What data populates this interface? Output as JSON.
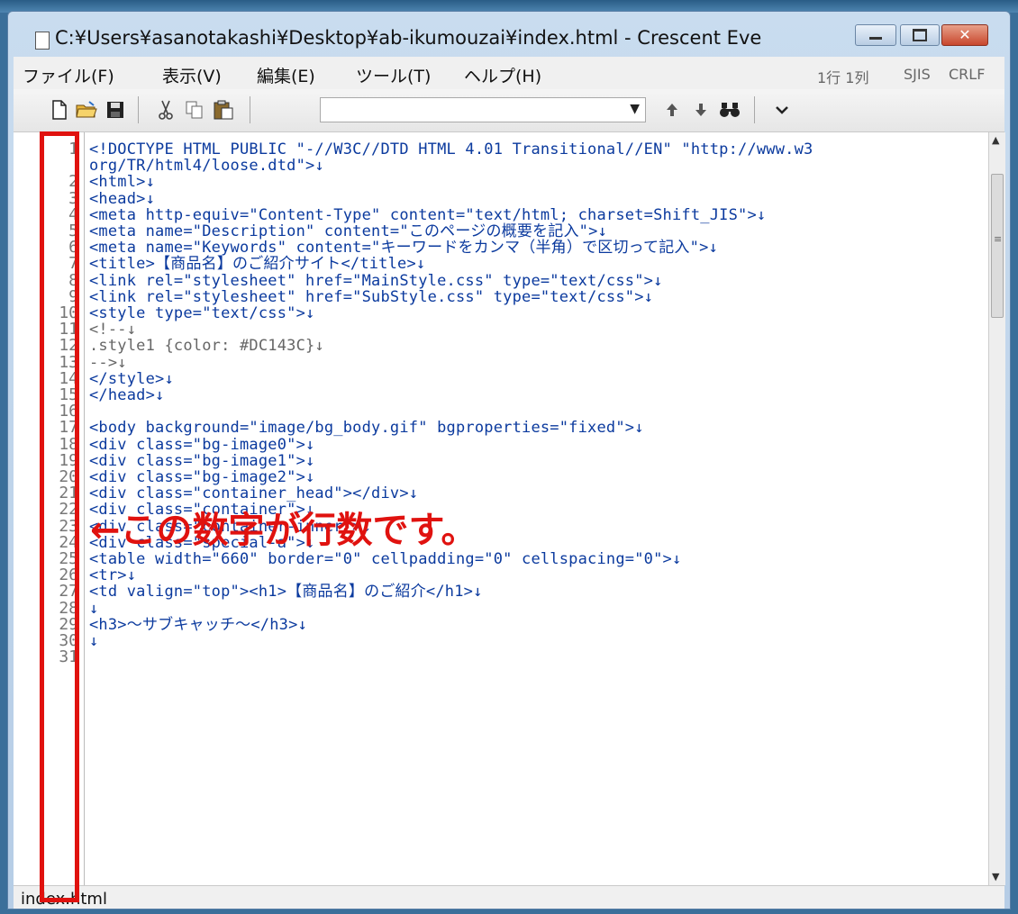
{
  "window": {
    "title": "C:¥Users¥asanotakashi¥Desktop¥ab-ikumouzai¥index.html - Crescent Eve"
  },
  "menu": {
    "items": [
      {
        "label": "ファイル(F)"
      },
      {
        "label": "表示(V)"
      },
      {
        "label": "編集(E)"
      },
      {
        "label": "ツール(T)"
      },
      {
        "label": "ヘルプ(H)"
      }
    ],
    "status_position": "1行 1列",
    "status_encoding": "SJIS",
    "status_newline": "CRLF"
  },
  "toolbar": {
    "icons": [
      "new-file-icon",
      "open-folder-icon",
      "save-icon",
      "cut-icon",
      "copy-icon",
      "paste-icon"
    ],
    "search_value": "",
    "nav_icons": [
      "arrow-up-icon",
      "arrow-down-icon",
      "find-icon",
      "chevron-down-icon"
    ]
  },
  "editor": {
    "line_numbers": [
      "1",
      "",
      "2",
      "3",
      "4",
      "5",
      "6",
      "7",
      "8",
      "9",
      "10",
      "11",
      "12",
      "13",
      "14",
      "15",
      "16",
      "17",
      "18",
      "19",
      "20",
      "21",
      "22",
      "23",
      "24",
      "25",
      "26",
      "27",
      "28",
      "29",
      "30",
      "31"
    ],
    "lines": [
      "<!DOCTYPE HTML PUBLIC \"-//W3C//DTD HTML 4.01 Transitional//EN\" \"http://www.w3",
      "org/TR/html4/loose.dtd\">↓",
      "<html>↓",
      "<head>↓",
      "<meta http-equiv=\"Content-Type\" content=\"text/html; charset=Shift_JIS\">↓",
      "<meta name=\"Description\" content=\"このページの概要を記入\">↓",
      "<meta name=\"Keywords\" content=\"キーワードをカンマ（半角）で区切って記入\">↓",
      "<title>【商品名】のご紹介サイト</title>↓",
      "<link rel=\"stylesheet\" href=\"MainStyle.css\" type=\"text/css\">↓",
      "<link rel=\"stylesheet\" href=\"SubStyle.css\" type=\"text/css\">↓",
      "<style type=\"text/css\">↓",
      "<!--↓",
      ".style1 {color: #DC143C}↓",
      "-->↓",
      "</style>↓",
      "</head>↓",
      "",
      "<body background=\"image/bg_body.gif\" bgproperties=\"fixed\">↓",
      "<div class=\"bg-image0\">↓",
      "<div class=\"bg-image1\">↓",
      "<div class=\"bg-image2\">↓",
      "<div class=\"container_head\"></div>↓",
      "<div class=\"container\">↓",
      "<div class=\"container-inner\">↓",
      "<div class=\"special-a\">↓",
      "<table width=\"660\" border=\"0\" cellpadding=\"0\" cellspacing=\"0\">↓",
      "<tr>↓",
      "<td valign=\"top\"><h1>【商品名】のご紹介</h1>↓",
      "↓",
      "<h3>～サブキャッチ～</h3>↓",
      "↓",
      ""
    ]
  },
  "status_bar": {
    "tab_label": "index.html"
  },
  "annotation": {
    "text": "←この数字が行数です。"
  },
  "colors": {
    "annotation_red": "#e0120f",
    "code_blue": "#0b3a9e",
    "comment_gray": "#666666"
  }
}
